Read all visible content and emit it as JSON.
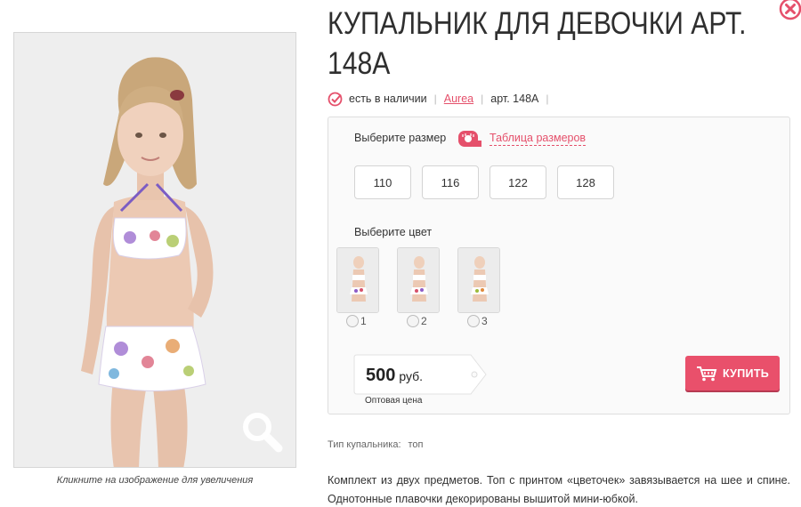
{
  "product": {
    "title": "КУПАЛЬНИК ДЛЯ ДЕВОЧКИ АРТ. 148А",
    "availability": "есть в наличии",
    "brand": "Aurea",
    "article": "арт. 148А"
  },
  "image": {
    "caption": "Кликните на изображение для увеличения",
    "zoom_icon": "magnifier-icon"
  },
  "options": {
    "size_label": "Выберите размер",
    "size_table_link": "Таблица размеров",
    "sizes": [
      "110",
      "116",
      "122",
      "128"
    ],
    "color_label": "Выберите цвет",
    "colors": [
      {
        "label": "1"
      },
      {
        "label": "2"
      },
      {
        "label": "3"
      }
    ]
  },
  "price": {
    "amount": "500",
    "currency": "руб.",
    "note": "Оптовая цена"
  },
  "buy_button": {
    "label": "КУПИТЬ",
    "color": "#e9506b"
  },
  "attributes": {
    "swimsuit_type_label": "Тип купальника:",
    "swimsuit_type_value": "топ"
  },
  "description": "Комплект из двух предметов. Топ с принтом «цветочек» завязывается на шее и спине. Однотонные плавочки декорированы вышитой мини-юбкой.",
  "colors": {
    "accent": "#e5506b",
    "text": "#333333"
  }
}
